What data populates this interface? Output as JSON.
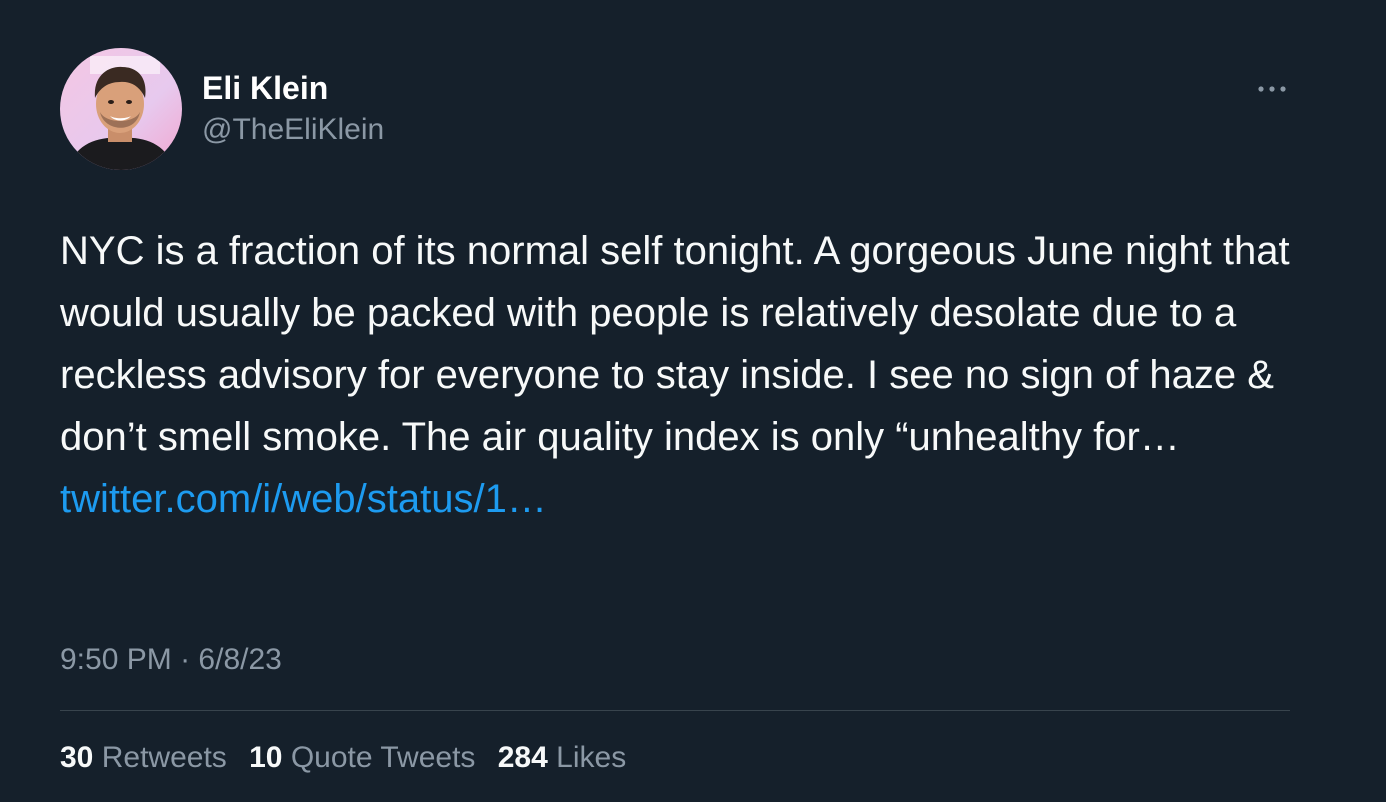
{
  "author": {
    "display_name": "Eli Klein",
    "handle": "@TheEliKlein",
    "avatar_icon": "profile-photo"
  },
  "more_icon": "ellipsis-icon",
  "tweet": {
    "text": "NYC is a fraction of its normal self tonight. A gorgeous June night that would usually be packed with people is relatively desolate due to a reckless advisory for everyone to stay inside. I see no sign of haze & don’t smell smoke. The air quality index is only “unhealthy for…",
    "link_text": "twitter.com/i/web/status/1…"
  },
  "meta": {
    "time": "9:50 PM",
    "separator": "·",
    "date": "6/8/23"
  },
  "stats": {
    "retweets_count": "30",
    "retweets_label": "Retweets",
    "quotes_count": "10",
    "quotes_label": "Quote Tweets",
    "likes_count": "284",
    "likes_label": "Likes"
  },
  "colors": {
    "background": "#15202b",
    "text": "#f7f9f9",
    "secondary": "#8b98a5",
    "link": "#1d9bf0",
    "divider": "#38444d"
  }
}
